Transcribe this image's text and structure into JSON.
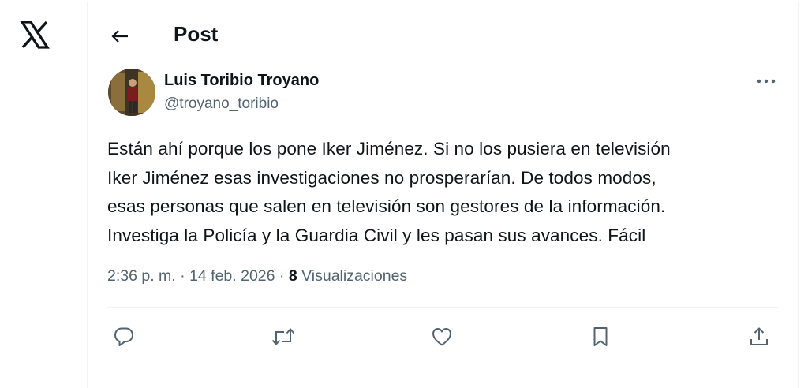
{
  "app": {
    "logo_icon": "x-logo-icon"
  },
  "header": {
    "title": "Post",
    "back_icon": "arrow-left-icon"
  },
  "post": {
    "author_name": "Luis Toribio Troyano",
    "author_handle": "@troyano_toribio",
    "text": "Están ahí porque los pone Iker Jiménez. Si no los pusiera en televisión\nIker Jiménez esas investigaciones no prosperarían. De todos modos,\nesas personas que salen en televisión son gestores de la información.\nInvestiga la Policía y la Guardia Civil y les pasan sus avances. Fácil",
    "time": "2:36 p. m.",
    "separator": "·",
    "date": "14 feb. 2026",
    "views_count": "8",
    "views_label": "Visualizaciones"
  },
  "actions": [
    "reply-icon",
    "repost-icon",
    "like-icon",
    "bookmark-icon",
    "share-icon"
  ],
  "colors": {
    "text": "#0f1419",
    "secondary": "#536471",
    "border": "#eff3f4"
  }
}
